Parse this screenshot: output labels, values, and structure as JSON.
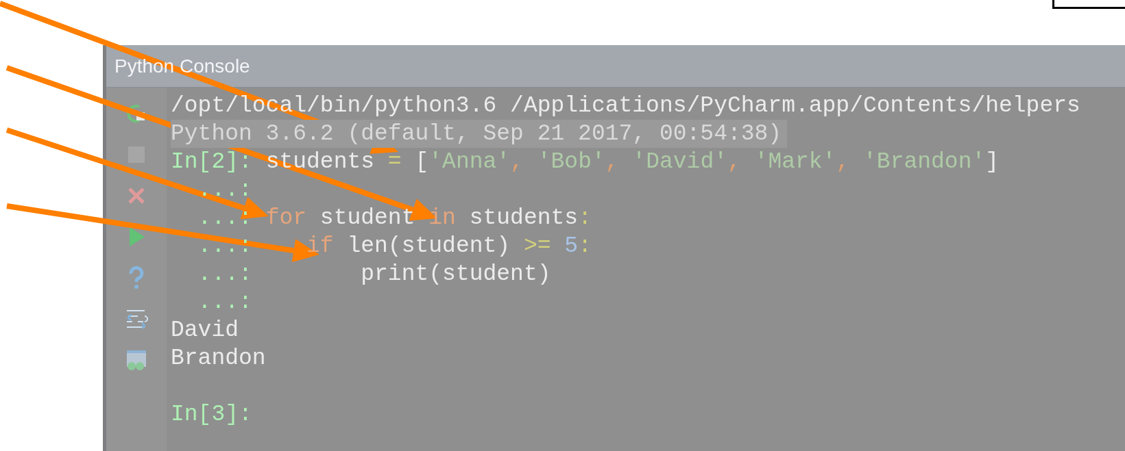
{
  "window": {
    "title": "Python Console"
  },
  "console": {
    "lines": [
      {
        "highlighted": false,
        "tokens": [
          {
            "kind": "plain",
            "text": "/opt/local/bin/python3.6 /Applications/PyCharm.app/Contents/helpers"
          }
        ]
      },
      {
        "highlighted": true,
        "tokens": [
          {
            "kind": "dim",
            "text": "Python 3.6.2 (default, Sep 21 2017, 00:54:38)"
          }
        ]
      },
      {
        "highlighted": false,
        "tokens": [
          {
            "kind": "prompt",
            "text": "In[2]: "
          },
          {
            "kind": "plain",
            "text": "students "
          },
          {
            "kind": "operator",
            "text": "="
          },
          {
            "kind": "plain",
            "text": " ["
          },
          {
            "kind": "string",
            "text": "'Anna'"
          },
          {
            "kind": "punct",
            "text": ", "
          },
          {
            "kind": "string",
            "text": "'Bob'"
          },
          {
            "kind": "punct",
            "text": ", "
          },
          {
            "kind": "string",
            "text": "'David'"
          },
          {
            "kind": "punct",
            "text": ", "
          },
          {
            "kind": "string",
            "text": "'Mark'"
          },
          {
            "kind": "punct",
            "text": ", "
          },
          {
            "kind": "string",
            "text": "'Brandon'"
          },
          {
            "kind": "plain",
            "text": "]"
          }
        ]
      },
      {
        "highlighted": false,
        "tokens": [
          {
            "kind": "prompt",
            "text": "  ...:"
          }
        ]
      },
      {
        "highlighted": false,
        "tokens": [
          {
            "kind": "prompt",
            "text": "  ...: "
          },
          {
            "kind": "keyword",
            "text": "for"
          },
          {
            "kind": "plain",
            "text": " student "
          },
          {
            "kind": "keyword",
            "text": "in"
          },
          {
            "kind": "plain",
            "text": " students"
          },
          {
            "kind": "operator",
            "text": ":"
          }
        ]
      },
      {
        "highlighted": false,
        "tokens": [
          {
            "kind": "prompt",
            "text": "  ...:    "
          },
          {
            "kind": "keyword",
            "text": "if"
          },
          {
            "kind": "plain",
            "text": " len(student) "
          },
          {
            "kind": "operator",
            "text": ">="
          },
          {
            "kind": "number",
            "text": " 5"
          },
          {
            "kind": "operator",
            "text": ":"
          }
        ]
      },
      {
        "highlighted": false,
        "tokens": [
          {
            "kind": "prompt",
            "text": "  ...:        "
          },
          {
            "kind": "plain",
            "text": "print(student)"
          }
        ]
      },
      {
        "highlighted": false,
        "tokens": [
          {
            "kind": "prompt",
            "text": "  ...:"
          }
        ]
      },
      {
        "highlighted": false,
        "tokens": [
          {
            "kind": "plain",
            "text": "David"
          }
        ]
      },
      {
        "highlighted": false,
        "tokens": [
          {
            "kind": "plain",
            "text": "Brandon"
          }
        ]
      }
    ],
    "input_prompt": "In[3]:"
  }
}
